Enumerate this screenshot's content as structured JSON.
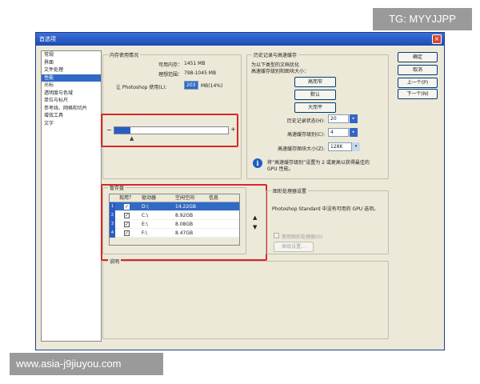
{
  "watermarks": {
    "top": "TG: MYYJJPP",
    "bottom": "www.asia-j9jiuyou.com"
  },
  "window": {
    "title": "首选项",
    "close_label": "×"
  },
  "sidebar": {
    "items": [
      {
        "label": "常规"
      },
      {
        "label": "界面"
      },
      {
        "label": "文件处理"
      },
      {
        "label": "性能"
      },
      {
        "label": "光标"
      },
      {
        "label": "透明度与色域"
      },
      {
        "label": "单位与标尺"
      },
      {
        "label": "参考线、网格和切片"
      },
      {
        "label": "增效工具"
      },
      {
        "label": "文字"
      }
    ]
  },
  "memory": {
    "title": "内存使用情况",
    "available_label": "可用内存：",
    "available_value": "1451 MB",
    "ideal_label": "理想范围：",
    "ideal_value": "798-1045 MB",
    "let_use_label": "让 Photoshop 使用(L):",
    "let_use_value": "203",
    "let_use_unit": "MB(14%)",
    "minus": "−",
    "plus": "+",
    "slider_fraction": 0.14
  },
  "history": {
    "title": "历史记录与高速缓存",
    "desc_line1": "为以下类型的文档优化",
    "desc_line2": "高速缓存级别和图块大小：",
    "btn_tall": "高而窄",
    "btn_default": "默认",
    "btn_wide": "大而平",
    "states_label": "历史记录状态(H):",
    "states_value": "20",
    "cache_levels_label": "高速缓存级别(C):",
    "cache_levels_value": "4",
    "tile_size_label": "高速缓存图块大小(Z):",
    "tile_size_value": "128K",
    "note_line1": "将“高速缓存级别”设置为 2 或更高以获得最佳的",
    "note_line2": "GPU 性能。"
  },
  "scratch": {
    "title": "暂存盘",
    "headers": [
      "现用？",
      "驱动器",
      "空闲空间",
      "信息"
    ],
    "rows": [
      {
        "num": "1",
        "check": "✓",
        "drive": "D:\\",
        "space": "14.22GB",
        "selected": true
      },
      {
        "num": "2",
        "check": "✓",
        "drive": "C:\\",
        "space": "8.92GB",
        "selected": false
      },
      {
        "num": "3",
        "check": "✓",
        "drive": "E:\\",
        "space": "8.08GB",
        "selected": false
      },
      {
        "num": "4",
        "check": "✓",
        "drive": "F:\\",
        "space": "8.47GB",
        "selected": false
      }
    ],
    "up": "▲",
    "down": "▼"
  },
  "gpu": {
    "title": "图形处理器设置",
    "desc": "Photoshop Standard 中没有可用的 GPU 选项。",
    "enable_label": "使用图形处理器(G)",
    "advanced_label": "高级设置..."
  },
  "description": {
    "title": "说明"
  },
  "buttons": {
    "ok": "确定",
    "cancel": "取消",
    "prev": "上一个(P)",
    "next": "下一个(N)"
  }
}
